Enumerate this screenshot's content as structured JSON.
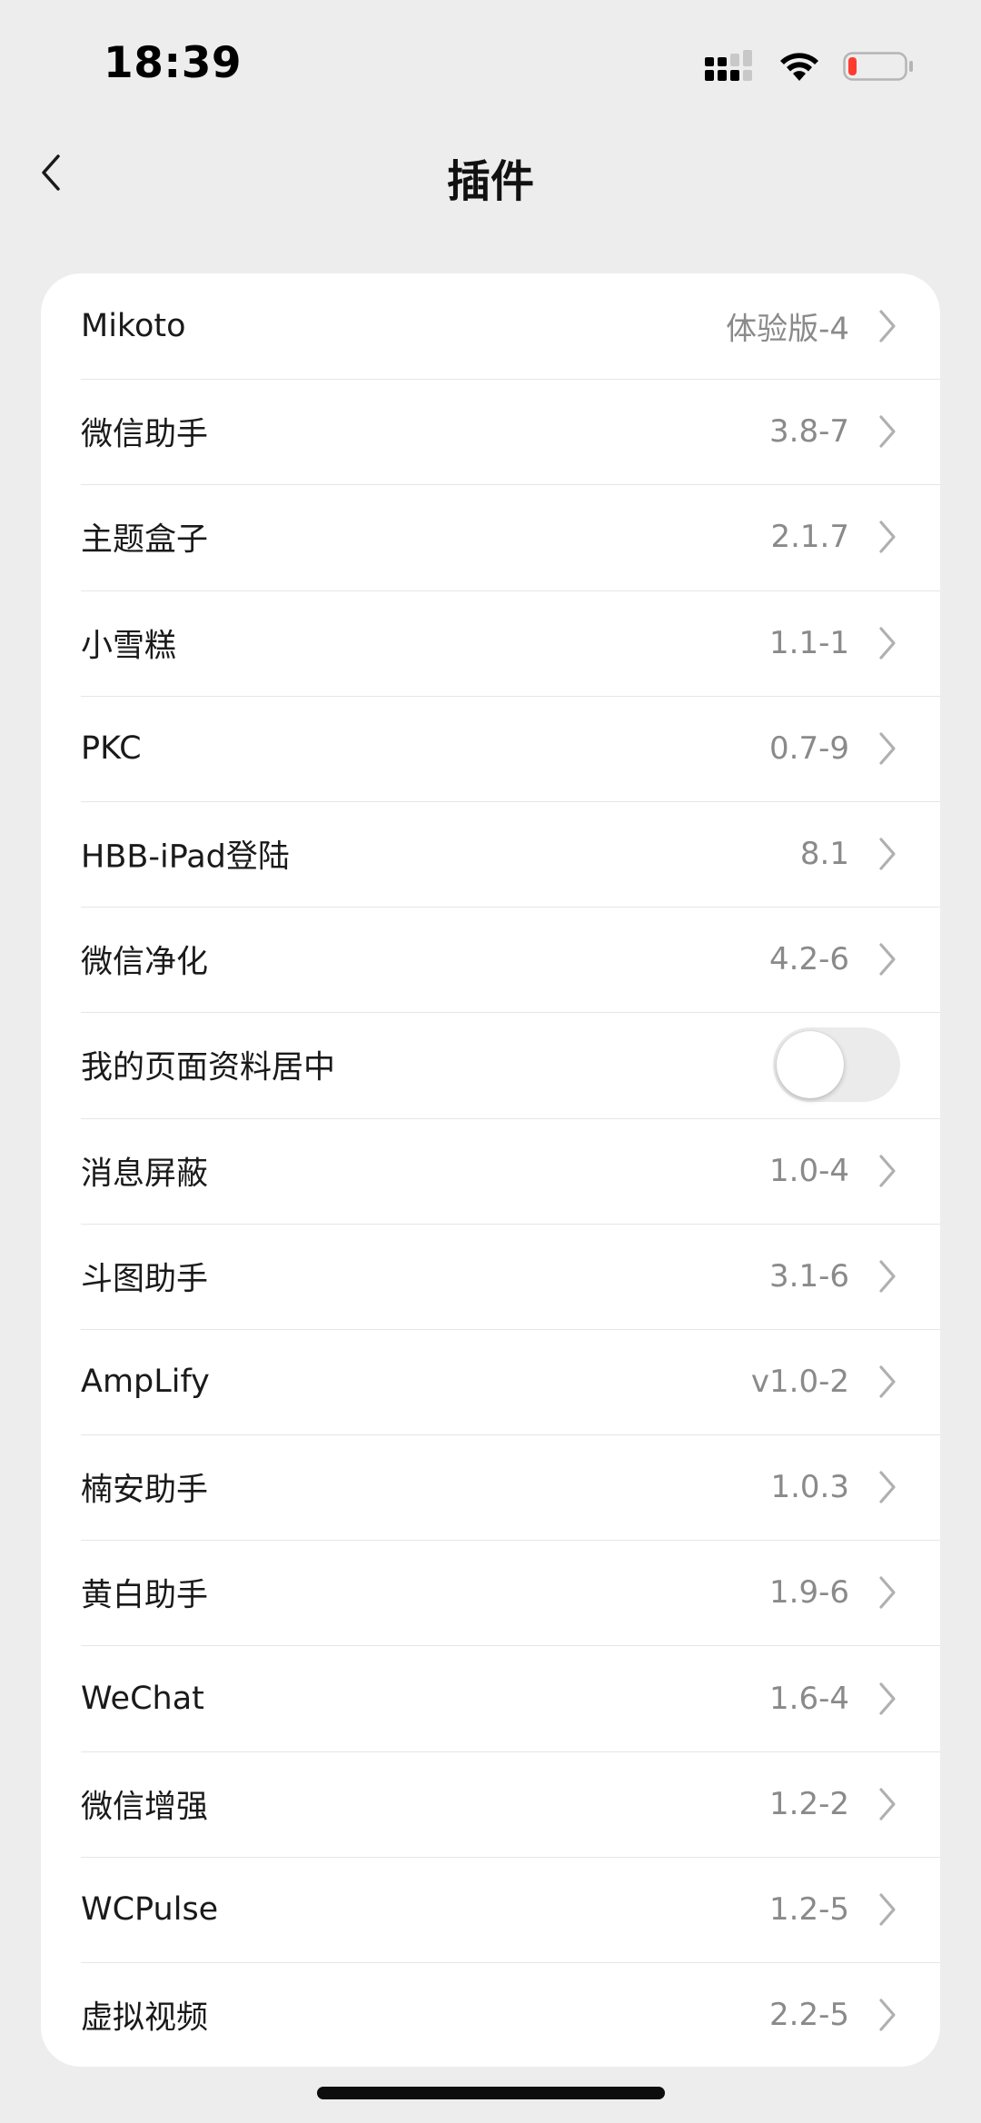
{
  "status_bar": {
    "time": "18:39",
    "icons": [
      "cellular-signal-icon",
      "wifi-icon",
      "battery-low-icon"
    ],
    "battery_color": "#ff3b30"
  },
  "nav": {
    "title": "插件",
    "back_icon": "chevron-left-icon"
  },
  "plugins": [
    {
      "name": "Mikoto",
      "version": "体验版-4"
    },
    {
      "name": "微信助手",
      "version": "3.8-7"
    },
    {
      "name": "主题盒子",
      "version": "2.1.7"
    },
    {
      "name": "小雪糕",
      "version": "1.1-1"
    },
    {
      "name": "PKC",
      "version": "0.7-9"
    },
    {
      "name": "HBB-iPad登陆",
      "version": "8.1"
    },
    {
      "name": "微信净化",
      "version": "4.2-6"
    },
    {
      "name": "我的页面资料居中",
      "toggle": true,
      "enabled": false
    },
    {
      "name": "消息屏蔽",
      "version": "1.0-4"
    },
    {
      "name": "斗图助手",
      "version": "3.1-6"
    },
    {
      "name": "AmpLify",
      "version": "v1.0-2"
    },
    {
      "name": "楠安助手",
      "version": "1.0.3"
    },
    {
      "name": "黄白助手",
      "version": "1.9-6"
    },
    {
      "name": "WeChat",
      "version": "1.6-4"
    },
    {
      "name": "微信增强",
      "version": "1.2-2"
    },
    {
      "name": "WCPulse",
      "version": "1.2-5"
    },
    {
      "name": "虚拟视频",
      "version": "2.2-5"
    }
  ],
  "colors": {
    "background": "#ededed",
    "card": "#ffffff",
    "version_text": "#8a8a8a",
    "chevron": "#b0b0b0"
  }
}
